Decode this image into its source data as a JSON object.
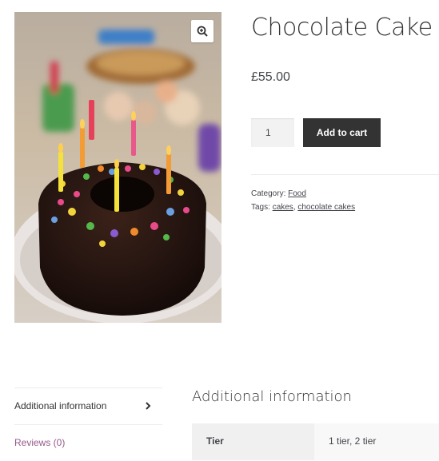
{
  "product": {
    "title": "Chocolate Cake",
    "price": "£55.00",
    "quantity": "1",
    "add_to_cart_label": "Add to cart",
    "category_label": "Category:",
    "category": "Food",
    "tags_label": "Tags:",
    "tags": [
      "cakes",
      "chocolate cakes"
    ],
    "tag_separator": ","
  },
  "tabs": {
    "items": [
      {
        "label": "Additional information"
      },
      {
        "label": "Reviews (0)"
      }
    ]
  },
  "panel": {
    "title": "Additional information",
    "attribute_label": "Tier",
    "attribute_value": "1 tier, 2 tier"
  },
  "icons": {
    "zoom": "zoom-in-icon",
    "tab_arrow": "chevron-right-icon"
  },
  "colors": {
    "button_bg": "#333333",
    "link_accent": "#96588a",
    "text": "#43454b"
  }
}
